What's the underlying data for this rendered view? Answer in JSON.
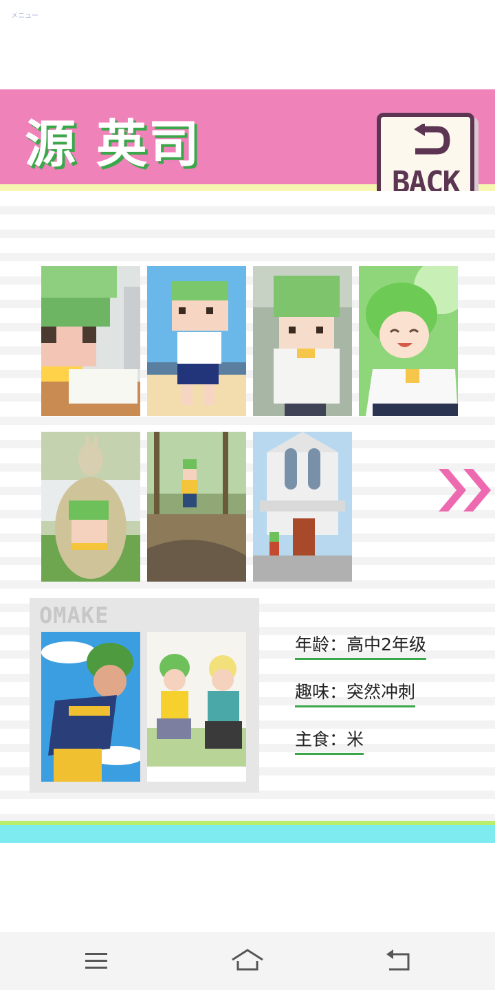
{
  "status": {
    "menu_label": "メニュー"
  },
  "header": {
    "title": "源 英司",
    "back_label": "BACK",
    "colors": {
      "banner": "#ee82b9",
      "title_shadow": "#3aa84a",
      "back_border": "#5b3551"
    }
  },
  "gallery": {
    "row1": [
      "pixel-cap-classroom-icon",
      "pixel-runner-icon",
      "pixel-boy-garden-icon",
      "smiling-boy-icon"
    ],
    "row2": [
      "kangaroo-statue-icon",
      "forest-stream-icon",
      "church-icon"
    ],
    "next_icon": "double-chevron-right-icon"
  },
  "omake": {
    "label": "OMAKE",
    "images": [
      "sporty-boy-icon",
      "two-boys-gaming-icon"
    ]
  },
  "profile": {
    "age": "年龄：高中2年级",
    "hobby": "趣味：突然冲刺",
    "staple": "主食：米"
  },
  "navbar": {
    "icons": [
      "menu-icon",
      "home-icon",
      "back-icon"
    ]
  }
}
